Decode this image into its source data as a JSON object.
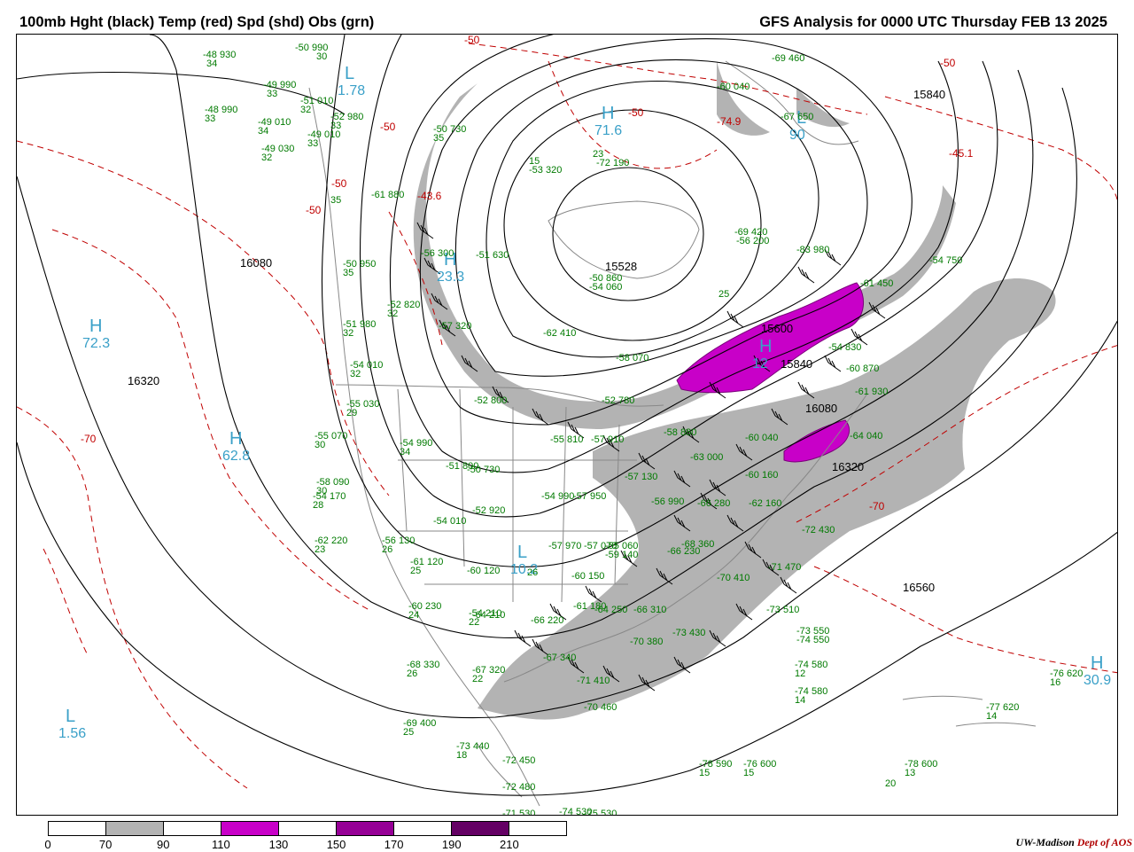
{
  "header": {
    "left_title": "100mb Hght (black) Temp (red) Spd (shd) Obs (grn)",
    "right_title": "GFS Analysis for 0000 UTC Thursday  FEB 13 2025"
  },
  "legend": {
    "colors": [
      "#ffffff",
      "#b3b3b3",
      "#ffffff",
      "#c800c8",
      "#ffffff",
      "#960096",
      "#ffffff",
      "#640064",
      "#ffffff"
    ],
    "labels": [
      "0",
      "70",
      "90",
      "110",
      "130",
      "150",
      "170",
      "190",
      "210"
    ]
  },
  "credit": {
    "org": "UW-Madison",
    "dept": "Dept of AOS"
  },
  "colors": {
    "height_contour": "#000000",
    "temp_contour": "#c00000",
    "speed_70_90": "#b3b3b3",
    "speed_110_130": "#c800c8",
    "obs": "#007a00",
    "highs_lows": "#3aa0c8",
    "border": "#888888"
  },
  "map": {
    "height_labels": [
      "16080",
      "16320",
      "15528",
      "15600",
      "15840",
      "16080",
      "16320",
      "16560",
      "15840"
    ],
    "temp_labels": [
      "-50",
      "-50",
      "-50",
      "-50",
      "-70",
      "-43.6",
      "-74.9",
      "-45.1",
      "-50",
      "-50",
      "-70"
    ],
    "highs_lows": [
      {
        "sym": "L",
        "val": "1.78"
      },
      {
        "sym": "H",
        "val": "71.6"
      },
      {
        "sym": "L",
        "val": "10.2"
      },
      {
        "sym": "H",
        "val": "23.3"
      },
      {
        "sym": "H",
        "val": "72.3"
      },
      {
        "sym": "H",
        "val": "62.8"
      },
      {
        "sym": "L",
        "val": "1.56"
      },
      {
        "sym": "H",
        "val": "30.9"
      },
      {
        "sym": "H",
        "val": "12"
      },
      {
        "sym": "L",
        "val": "90"
      }
    ],
    "obs_labels": [
      "-48 930",
      "34",
      "-50 990",
      "30",
      "-49 990",
      "33",
      "-51 010",
      "32",
      "-48 990",
      "33",
      "-49 010",
      "34",
      "-49 010",
      "33",
      "-49 030",
      "32",
      "-52 980",
      "33",
      "-50 730",
      "35",
      "-61 880",
      "35",
      "-50 950",
      "35",
      "-52 820",
      "32",
      "-51 980",
      "32",
      "-54 010",
      "32",
      "-55 030",
      "29",
      "-55 070",
      "30",
      "-54 990",
      "34",
      "-58 090",
      "30",
      "-54 170",
      "28",
      "-62 220",
      "23",
      "-56 130",
      "26",
      "-61 120",
      "25",
      "-60 230",
      "24",
      "-68 330",
      "26",
      "-69 400",
      "25",
      "-73 440",
      "18",
      "-72 450",
      "-72 480",
      "-71 530",
      "-74 530",
      "-75 530",
      "-78 590",
      "15",
      "-76 600",
      "15",
      "-78 600",
      "13",
      "-77 620",
      "14",
      "-76 620",
      "16",
      "-74 580",
      "12",
      "-74 580",
      "14",
      "-73 550",
      "-74 550",
      "-73 510",
      "-71 470",
      "-72 430",
      "-70 410",
      "-70 380",
      "-73 430",
      "-71 410",
      "-70 460",
      "-67 340",
      "-66 220",
      "-64 210",
      "-67 320",
      "22",
      "-54 210",
      "22",
      "-60 120",
      "26",
      "-60 150",
      "-61 180",
      "-64 250",
      "-66 310",
      "-68 360",
      "-66 230",
      "-66 280",
      "-60 160",
      "-62 160",
      "-60 040",
      "-63 000",
      "-58 880",
      "-57 910",
      "-55 810",
      "-52 780",
      "-52 800",
      "-50 730",
      "-51 800",
      "-52 920",
      "-54 010",
      "-54 990",
      "-57 950",
      "-57 970",
      "-57 070",
      "-55 060",
      "-59 140",
      "-57 130",
      "-56 990",
      "-58 070",
      "-62 410",
      "-57 320",
      "-51 630",
      "-56 300",
      "-50 860",
      "-54 060",
      "23",
      "-72 190",
      "15",
      "-53 320",
      "25",
      "-83 980",
      "-61 450",
      "-54 750",
      "-54 830",
      "-60 870",
      "-61 930",
      "-64 040",
      "-60 040",
      "-69 460",
      "-67 650",
      "-69 420",
      "-56 200",
      "20"
    ]
  }
}
